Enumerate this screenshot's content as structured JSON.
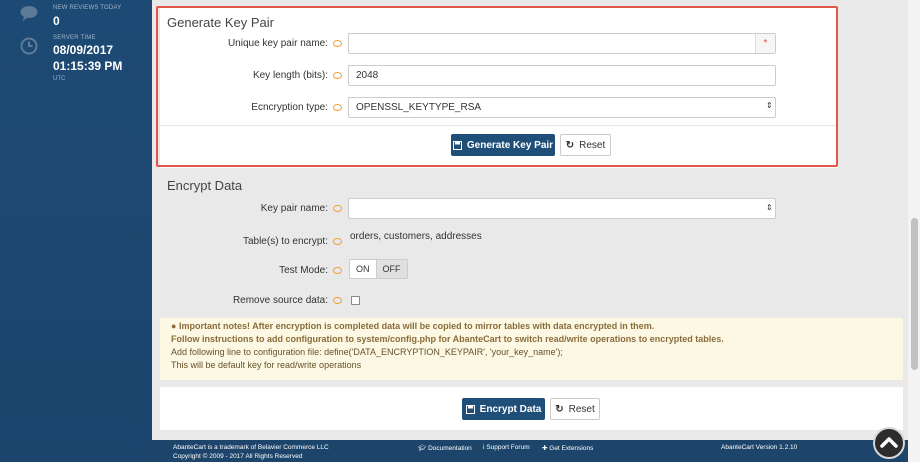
{
  "sidebar": {
    "reviews": {
      "label": "NEW REVIEWS TODAY",
      "value": "0",
      "icon": "chat-bubble-icon"
    },
    "server_time": {
      "label": "SERVER TIME",
      "date": "08/09/2017",
      "time": "01:15:39 PM",
      "tz": "UTC",
      "icon": "clock-icon"
    }
  },
  "generate": {
    "title": "Generate Key Pair",
    "name_label": "Unique key pair name:",
    "name_value": "",
    "required_mark": "*",
    "length_label": "Key length (bits):",
    "length_value": "2048",
    "type_label": "Ecncryption type:",
    "type_value": "OPENSSL_KEYTYPE_RSA",
    "generate_button": "Generate Key Pair",
    "reset_button": "Reset"
  },
  "encrypt": {
    "title": "Encrypt Data",
    "keypair_label": "Key pair name:",
    "keypair_value": "",
    "tables_label": "Table(s) to encrypt:",
    "tables_value": "orders, customers, addresses",
    "test_label": "Test Mode:",
    "test_on": "ON",
    "test_off": "OFF",
    "remove_label": "Remove source data:",
    "encrypt_button": "Encrypt Data",
    "reset_button": "Reset"
  },
  "notes": {
    "line1": "Important notes! After encryption is completed data will be copied to mirror tables with data encrypted in them.",
    "line2": "Follow instructions to add configuration to system/config.php for AbanteCart to switch read/write operations to encrypted tables.",
    "line3": "Add following line to configuration file: define('DATA_ENCRYPTION_KEYPAIR', 'your_key_name');",
    "line4": "This will be default key for read/write operations"
  },
  "footer": {
    "trademark": "AbanteCart is a trademark of Belavier Commerce LLC",
    "copyright": "Copyright © 2009 - 2017 All Rights Reserved",
    "documentation": "Documentation",
    "support": "Support Forum",
    "extensions": "Get Extensions",
    "version": "AbanteCart Version 1.2.10"
  },
  "colors": {
    "sidebar": "#1b456d",
    "primary": "#1f4e79",
    "highlight": "#e2574c",
    "notes_bg": "#fcf8e3"
  }
}
